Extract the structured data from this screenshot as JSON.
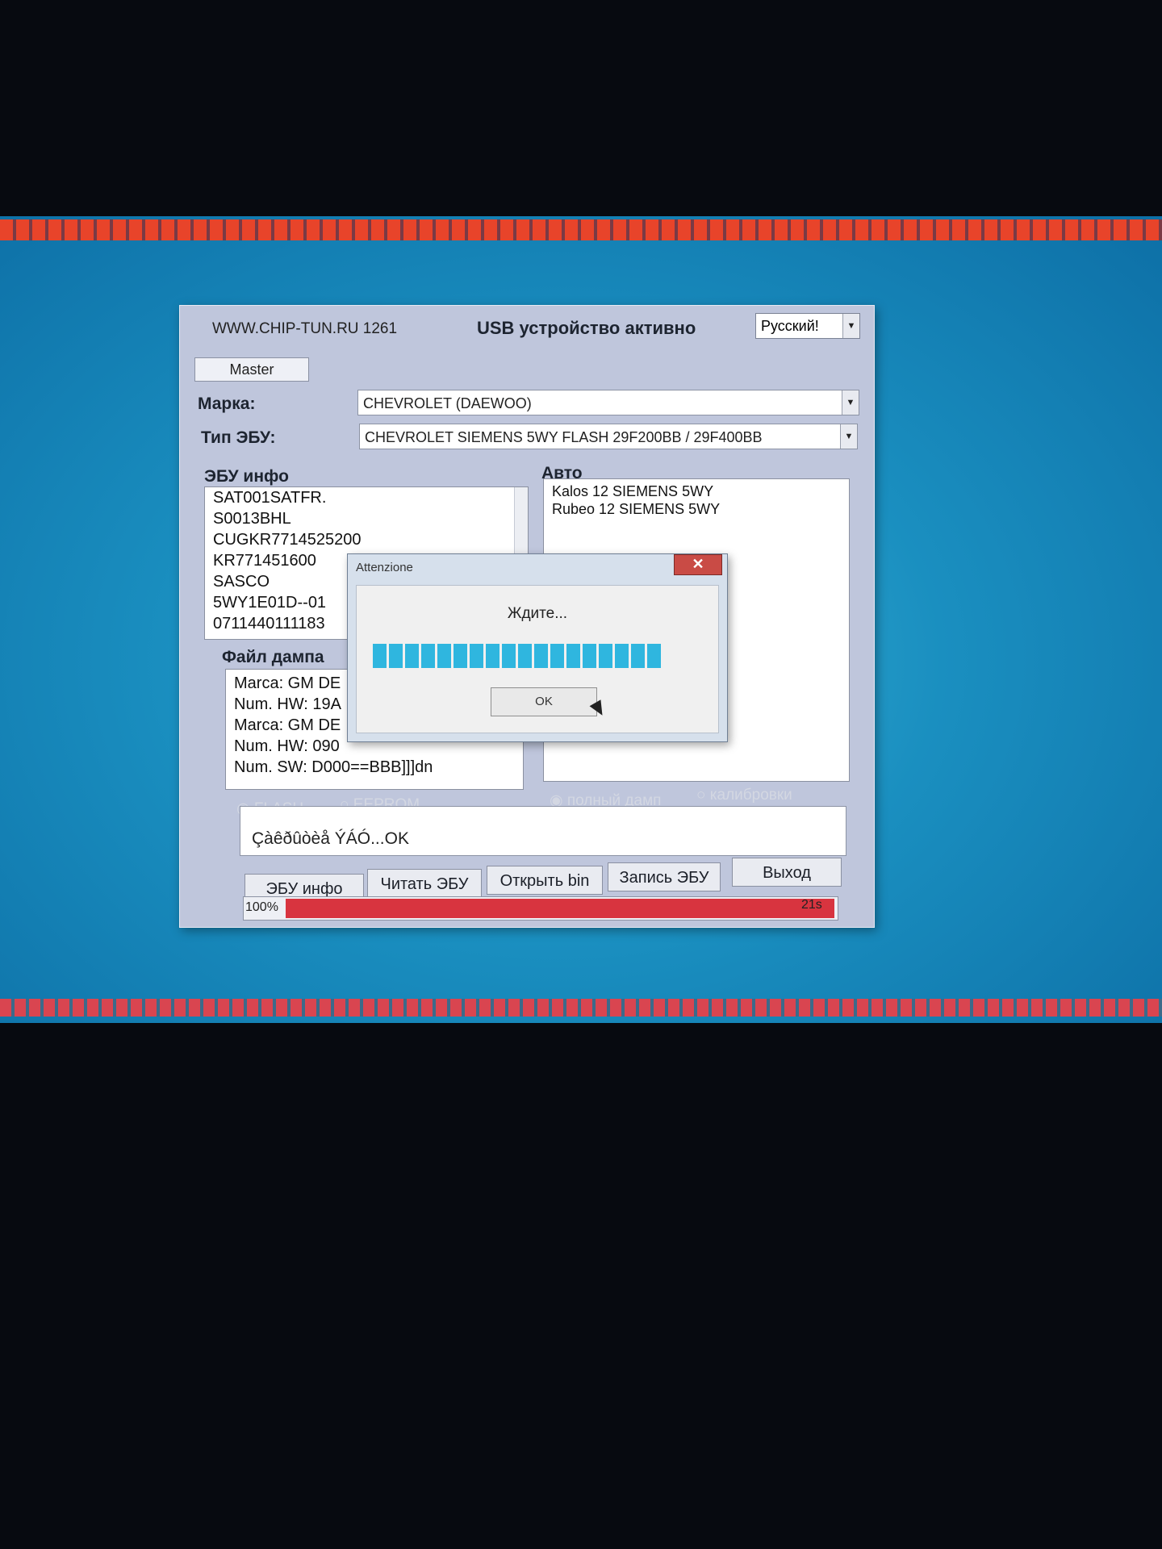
{
  "app": {
    "site": "WWW.CHIP-TUN.RU 1261",
    "status": "USB устройство активно",
    "language": "Русский!",
    "master_button": "Master",
    "brand_label": "Марка:",
    "brand_value": "CHEVROLET (DAEWOO)",
    "ecu_type_label": "Тип ЭБУ:",
    "ecu_type_value": "CHEVROLET SIEMENS 5WY FLASH 29F200BB / 29F400BB",
    "ecu_info_title": "ЭБУ инфо",
    "ecu_info_lines": [
      "SAT001SATFR.",
      "S0013BHL",
      "CUGKR7714525200",
      "KR771451600",
      "SASCO",
      "5WY1E01D--01",
      "0711440111183"
    ],
    "auto_title": "Авто",
    "auto_lines": [
      "Kalos 12 SIEMENS 5WY",
      "Rubeo 12 SIEMENS 5WY"
    ],
    "dump_title": "Файл дампа",
    "dump_lines": [
      "Marca: GM DE",
      "Num. HW: 19A",
      "Marca: GM DE",
      "Num. HW: 090",
      "Num. SW: D000==BBB]]]dn"
    ],
    "radio_flash": "FLASH",
    "radio_eeprom": "EEPROM",
    "radio_full": "полный дамп",
    "radio_calib": "калибровки",
    "log_text": "Çàêðûòèå ÝÁÓ...OK",
    "buttons": {
      "ecu_info": "ЭБУ инфо",
      "read_ecu": "Читать ЭБУ",
      "open_bin": "Открыть bin",
      "write_ecu": "Запись ЭБУ",
      "exit": "Выход"
    },
    "progress_label": "100%",
    "progress_value": 1.0,
    "timer": "21s"
  },
  "dialog": {
    "title": "Attenzione",
    "close": "✕",
    "message": "Ждите...",
    "ok": "OK",
    "progress_segments": 18
  },
  "colors": {
    "progress_red": "#d8343f",
    "dialog_progress": "#2fb6df",
    "window_bg": "#bfc6dc"
  }
}
